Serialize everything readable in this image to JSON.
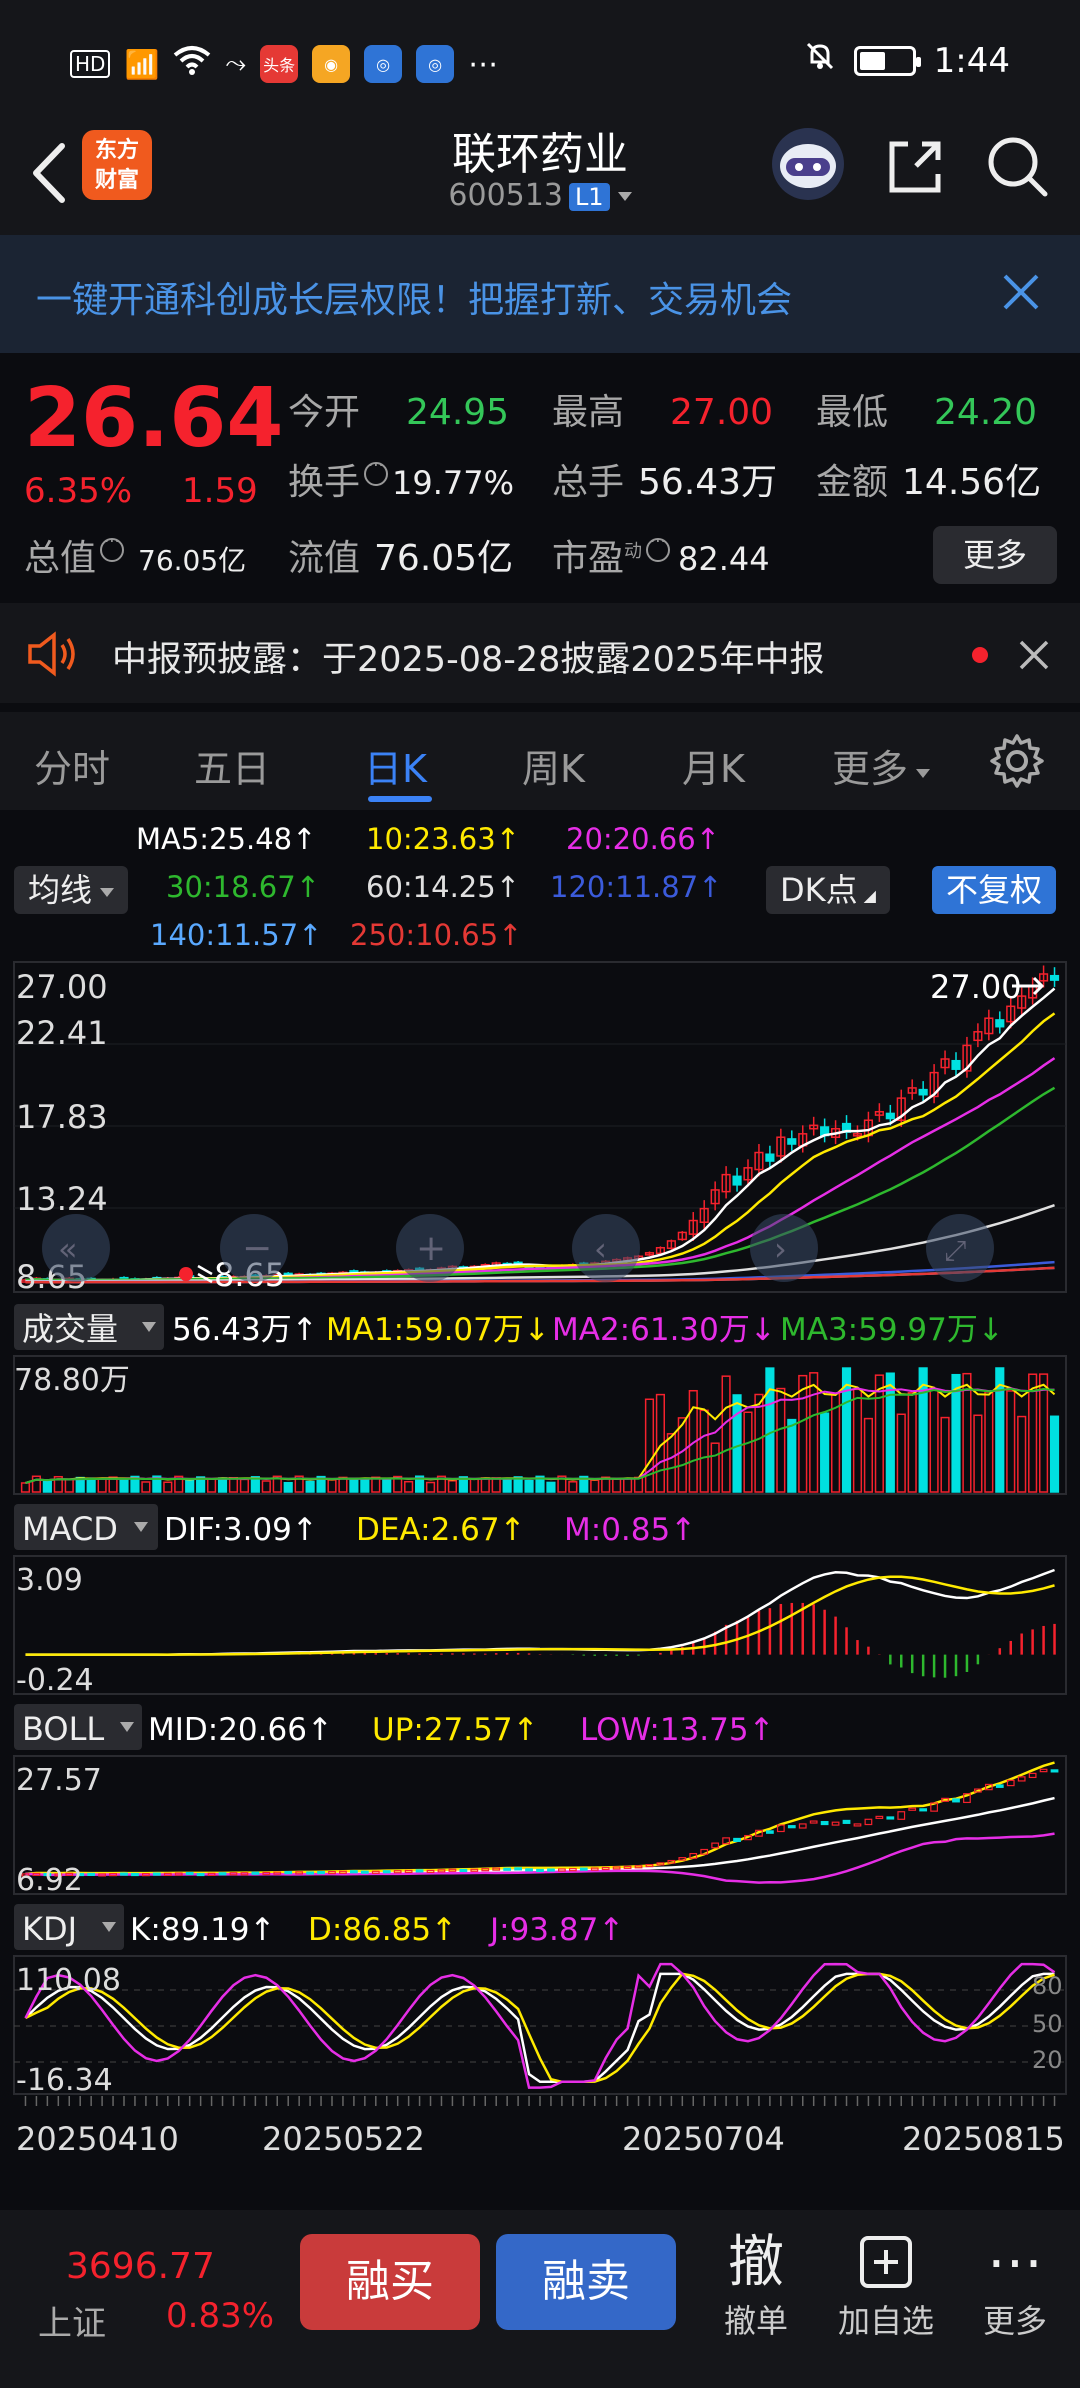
{
  "status_bar": {
    "left_icons": [
      "HD",
      "5G",
      "signal",
      "wifi",
      "app-头条",
      "app-微博",
      "app-1",
      "app-2",
      "⋯"
    ],
    "badge_toutiao": "头条",
    "more": "⋯",
    "time": "1:44"
  },
  "header": {
    "logo_text_line1": "东方",
    "logo_text_line2": "财富",
    "stock_name": "联环药业",
    "stock_code": "600513",
    "level_badge": "L1"
  },
  "banner": {
    "text": "一键开通科创成长层权限！把握打新、交易机会"
  },
  "quote": {
    "price": "26.64",
    "change_pct": "6.35%",
    "change": "1.59",
    "open_label": "今开",
    "open": "24.95",
    "high_label": "最高",
    "high": "27.00",
    "low_label": "最低",
    "low": "24.20",
    "turnover_label": "换手",
    "turnover": "19.77%",
    "volume_label": "总手",
    "volume": "56.43万",
    "amount_label": "金额",
    "amount": "14.56亿",
    "mktcap_label": "总值",
    "mktcap": "76.05亿",
    "float_label": "流值",
    "float": "76.05亿",
    "pe_label": "市盈",
    "pe_sup": "动",
    "pe": "82.44",
    "more_label": "更多"
  },
  "notice": {
    "text": "中报预披露：于2025-08-28披露2025年中报"
  },
  "tabs": [
    {
      "label": "分时"
    },
    {
      "label": "五日"
    },
    {
      "label": "日K"
    },
    {
      "label": "周K"
    },
    {
      "label": "月K"
    },
    {
      "label": "更多"
    }
  ],
  "ma_legend": {
    "selector": "均线",
    "dk_label": "DK点",
    "adjust_label": "不复权",
    "ma5": "MA5:25.48↑",
    "ma10": "10:23.63↑",
    "ma20": "20:20.66↑",
    "ma30": "30:18.67↑",
    "ma60": "60:14.25↑",
    "ma120": "120:11.87↑",
    "ma140": "140:11.57↑",
    "ma250": "250:10.65↑",
    "colors": {
      "ma5": "#ffffff",
      "ma10": "#ffea00",
      "ma20": "#e62ee6",
      "ma30": "#2eb82e",
      "ma60": "#e0e0e0",
      "ma120": "#3b5bdb",
      "ma140": "#5aa9ff",
      "ma250": "#e53935"
    }
  },
  "main_chart": {
    "y_ticks": [
      "27.00",
      "22.41",
      "17.83",
      "13.24",
      "8.65"
    ],
    "high_marker": "27.00",
    "low_marker": "8.65"
  },
  "volume_panel": {
    "selector": "成交量",
    "value": "56.43万↑",
    "ma1": "MA1:59.07万↓",
    "ma2": "MA2:61.30万↓",
    "ma3": "MA3:59.97万↓",
    "y_max": "78.80万"
  },
  "macd_panel": {
    "selector": "MACD",
    "dif": "DIF:3.09↑",
    "dea": "DEA:2.67↑",
    "m": "M:0.85↑",
    "y_max": "3.09",
    "y_min": "-0.24"
  },
  "boll_panel": {
    "selector": "BOLL",
    "mid": "MID:20.66↑",
    "up": "UP:27.57↑",
    "low": "LOW:13.75↑",
    "y_max": "27.57",
    "y_min": "6.92"
  },
  "kdj_panel": {
    "selector": "KDJ",
    "k": "K:89.19↑",
    "d": "D:86.85↑",
    "j": "J:93.87↑",
    "y_max": "110.08",
    "y_min": "-16.34",
    "levels": [
      "80",
      "50",
      "20"
    ]
  },
  "x_axis_dates": [
    "20250410",
    "20250522",
    "20250704",
    "20250815"
  ],
  "bottom_bar": {
    "index_value": "3696.77",
    "index_name": "上证",
    "index_pct": "0.83%",
    "buy_label": "融买",
    "sell_label": "融卖",
    "cancel_icon": "撤",
    "cancel_label": "撤单",
    "watch_label": "加自选",
    "more_label": "更多"
  },
  "chart_data": {
    "type": "candlestick",
    "y_range": [
      8.65,
      27.0
    ],
    "closes": [
      9.0,
      9.1,
      8.9,
      9.0,
      9.1,
      9.0,
      8.95,
      9.0,
      9.05,
      9.1,
      9.0,
      9.05,
      9.1,
      9.1,
      9.15,
      9.1,
      9.05,
      9.1,
      9.15,
      9.2,
      9.2,
      9.15,
      9.25,
      9.3,
      9.3,
      9.35,
      9.3,
      9.35,
      9.4,
      9.45,
      9.5,
      9.4,
      9.45,
      9.5,
      9.55,
      9.6,
      9.55,
      9.6,
      9.7,
      9.8,
      9.75,
      9.8,
      9.9,
      10.0,
      9.95,
      9.9,
      9.8,
      9.75,
      9.8,
      9.85,
      9.9,
      9.95,
      10.0,
      10.1,
      10.2,
      10.3,
      10.4,
      10.6,
      10.9,
      11.3,
      11.8,
      12.5,
      13.2,
      14.3,
      15.2,
      14.6,
      15.6,
      16.5,
      16.0,
      17.4,
      17.0,
      17.6,
      18.1,
      17.5,
      17.9,
      17.7,
      17.6,
      18.4,
      18.9,
      18.5,
      19.7,
      20.3,
      19.9,
      21.2,
      22.0,
      21.4,
      22.8,
      23.6,
      24.4,
      23.9,
      25.1,
      25.7,
      26.3,
      27.0,
      26.64
    ]
  }
}
